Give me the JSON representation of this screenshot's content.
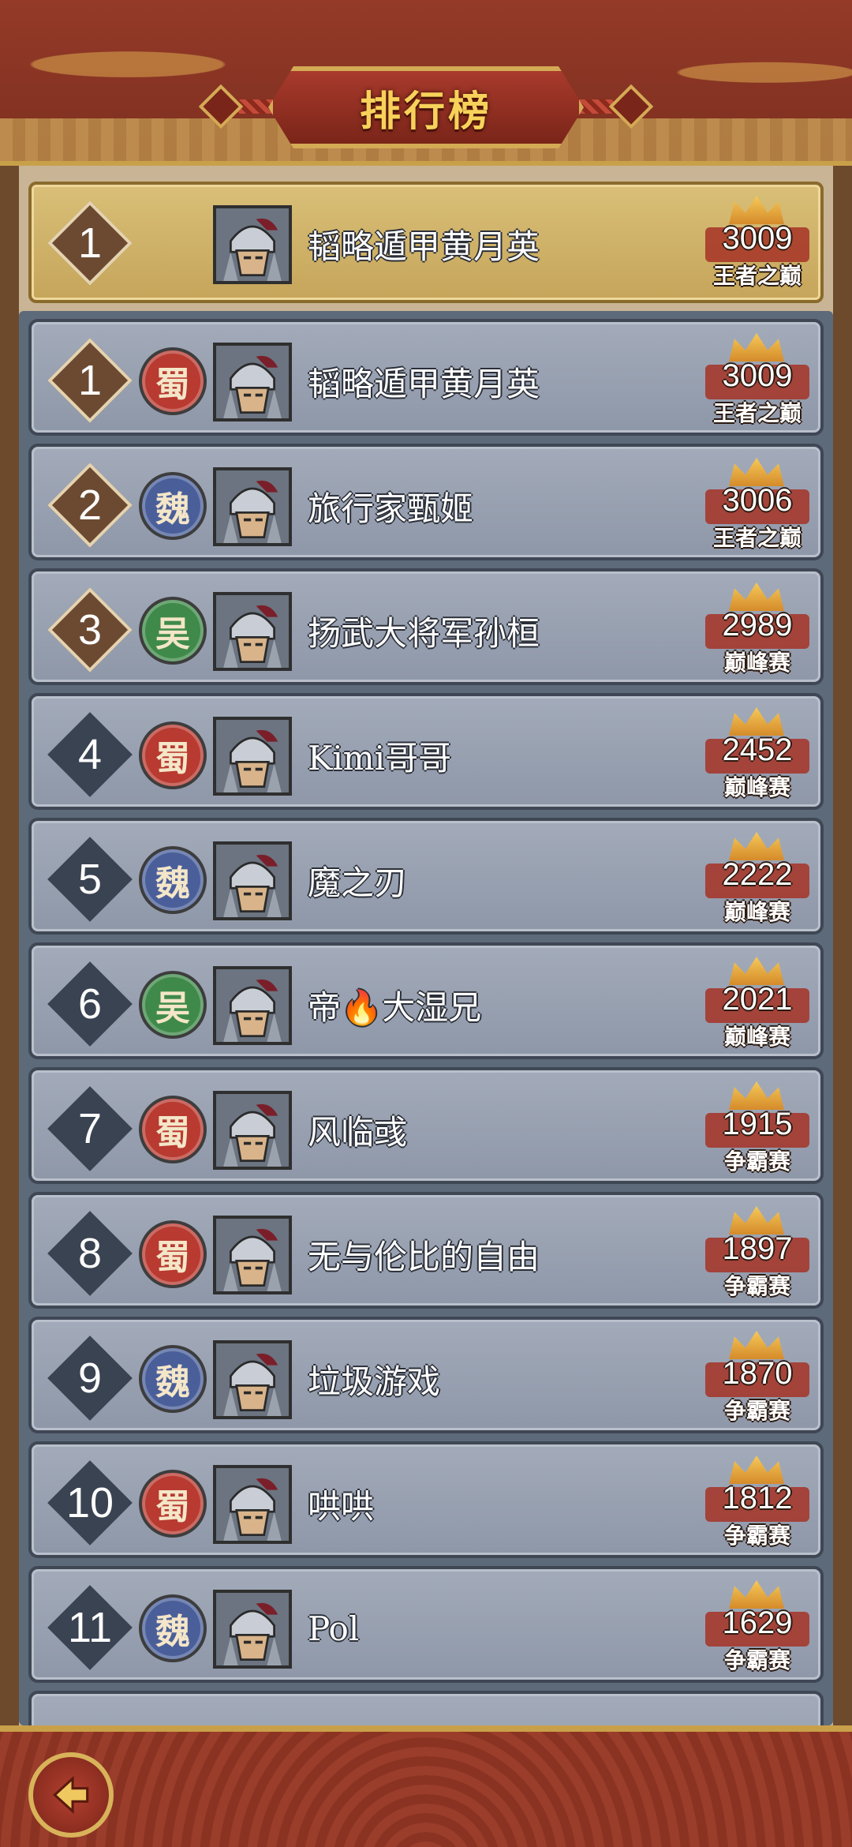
{
  "header": {
    "title": "排行榜"
  },
  "self_entry": {
    "rank": "1",
    "name": "韬略遁甲黄月英",
    "score": "3009",
    "tier": "王者之巅"
  },
  "rows": [
    {
      "rank": "1",
      "faction": "蜀",
      "name": "韬略遁甲黄月英",
      "score": "3009",
      "tier": "王者之巅"
    },
    {
      "rank": "2",
      "faction": "魏",
      "name": "旅行家甄姬",
      "score": "3006",
      "tier": "王者之巅"
    },
    {
      "rank": "3",
      "faction": "吴",
      "name": "扬武大将军孙桓",
      "score": "2989",
      "tier": "巅峰赛"
    },
    {
      "rank": "4",
      "faction": "蜀",
      "name": "Kimi哥哥",
      "score": "2452",
      "tier": "巅峰赛"
    },
    {
      "rank": "5",
      "faction": "魏",
      "name": "魔之刃",
      "score": "2222",
      "tier": "巅峰赛"
    },
    {
      "rank": "6",
      "faction": "吴",
      "name": "帝🔥大湿兄",
      "score": "2021",
      "tier": "巅峰赛"
    },
    {
      "rank": "7",
      "faction": "蜀",
      "name": "风临彧",
      "score": "1915",
      "tier": "争霸赛"
    },
    {
      "rank": "8",
      "faction": "蜀",
      "name": "无与伦比的自由",
      "score": "1897",
      "tier": "争霸赛"
    },
    {
      "rank": "9",
      "faction": "魏",
      "name": "垃圾游戏",
      "score": "1870",
      "tier": "争霸赛"
    },
    {
      "rank": "10",
      "faction": "蜀",
      "name": "哄哄",
      "score": "1812",
      "tier": "争霸赛"
    },
    {
      "rank": "11",
      "faction": "魏",
      "name": "Pol",
      "score": "1629",
      "tier": "争霸赛"
    }
  ],
  "colors": {
    "shu": "#b83a30",
    "wei": "#4a5f9a",
    "wu": "#3f8a4a",
    "top_rank": "#6c4a32",
    "other_rank": "#3a4352"
  },
  "icons": {
    "back": "back-arrow-icon",
    "avatar": "helmet-warrior-avatar"
  }
}
